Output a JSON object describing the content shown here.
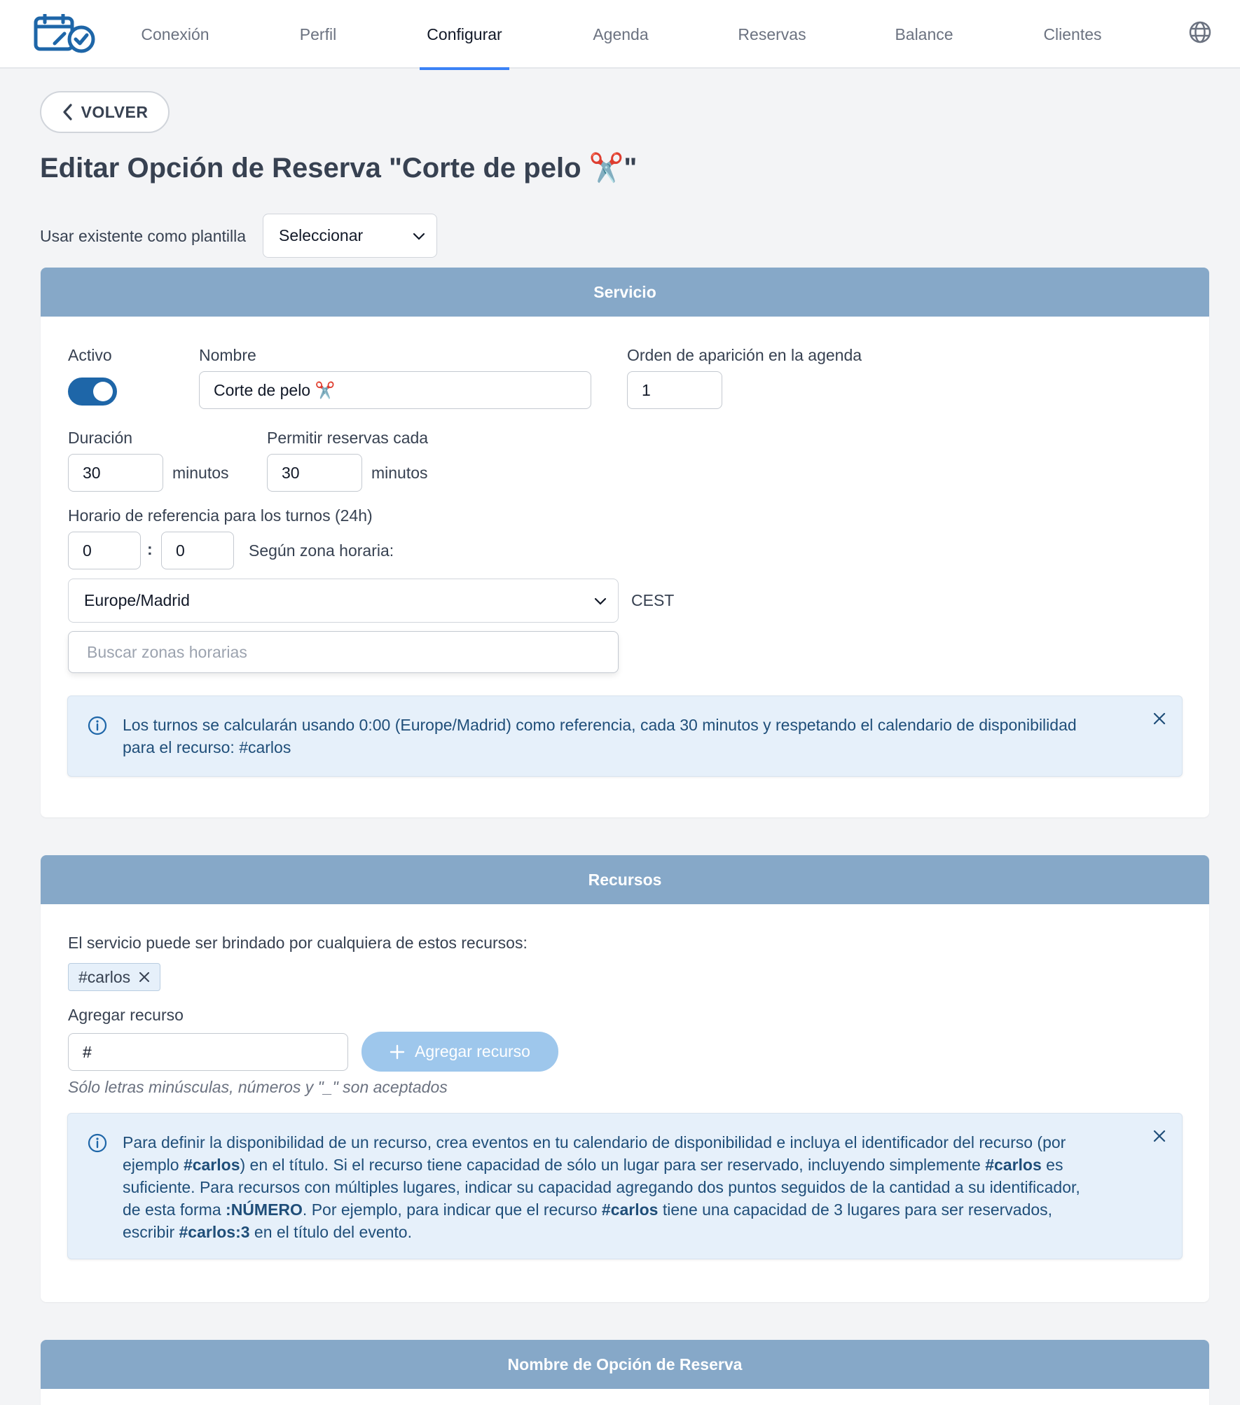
{
  "nav": {
    "items": [
      "Conexión",
      "Perfil",
      "Configurar",
      "Agenda",
      "Reservas",
      "Balance",
      "Clientes"
    ],
    "active": "Configurar"
  },
  "back_label": "VOLVER",
  "page_title": "Editar Opción de Reserva \"Corte de pelo ✂️\"",
  "template": {
    "label": "Usar existente como plantilla",
    "select_value": "Seleccionar"
  },
  "servicio": {
    "header": "Servicio",
    "activo_label": "Activo",
    "activo_on": true,
    "nombre_label": "Nombre",
    "nombre_value": "Corte de pelo ✂️",
    "orden_label": "Orden de aparición en la agenda",
    "orden_value": "1",
    "duracion_label": "Duración",
    "duracion_value": "30",
    "duracion_unit": "minutos",
    "permitir_label": "Permitir reservas cada",
    "permitir_value": "30",
    "permitir_unit": "minutos",
    "horario_label": "Horario de referencia para los turnos (24h)",
    "hour_value": "0",
    "colon": ":",
    "minute_value": "0",
    "zona_label": "Según zona horaria:",
    "timezone_value": "Europe/Madrid",
    "timezone_abbr": "CEST",
    "search_placeholder": "Buscar zonas horarias",
    "alert_line1": "Los turnos se calcularán usando 0:00 (Europe/Madrid) como referencia, cada 30 minutos y respetando el calendario de disponibilidad",
    "alert_line2": "para el recurso: #carlos"
  },
  "recursos": {
    "header": "Recursos",
    "intro": "El servicio puede ser brindado por cualquiera de estos recursos:",
    "tags": [
      "#carlos"
    ],
    "agregar_label": "Agregar recurso",
    "input_value": "#",
    "add_button": "Agregar recurso",
    "hint": "Sólo letras minúsculas, números y \"_\" son aceptados",
    "alert": {
      "l1": "Para definir la disponibilidad de un recurso, crea eventos en tu calendario de disponibilidad e incluya el identificador del recurso (por",
      "l2a": "ejemplo ",
      "l2b": "#carlos",
      "l2c": ") en el título. Si el recurso tiene capacidad de sólo un lugar para ser reservado, incluyendo simplemente ",
      "l2d": "#carlos",
      "l2e": " es",
      "l3": "suficiente. Para recursos con múltiples lugares, indicar su capacidad agregando dos puntos seguidos de la cantidad a su identificador,",
      "l4a": "de esta forma ",
      "l4b": ":NÚMERO",
      "l4c": ". Por ejemplo, para indicar que el recurso ",
      "l4d": "#carlos",
      "l4e": " tiene una capacidad de 3 lugares para ser reservados,",
      "l5a": "escribir ",
      "l5b": "#carlos:3",
      "l5c": " en el título del evento."
    }
  },
  "nombre_opcion": {
    "header": "Nombre de Opción de Reserva"
  },
  "colors": {
    "accent": "#3b82f6",
    "header_bg": "#86a8c8",
    "toggle_on": "#1e66a8",
    "alert_bg": "#e6f0fa"
  }
}
